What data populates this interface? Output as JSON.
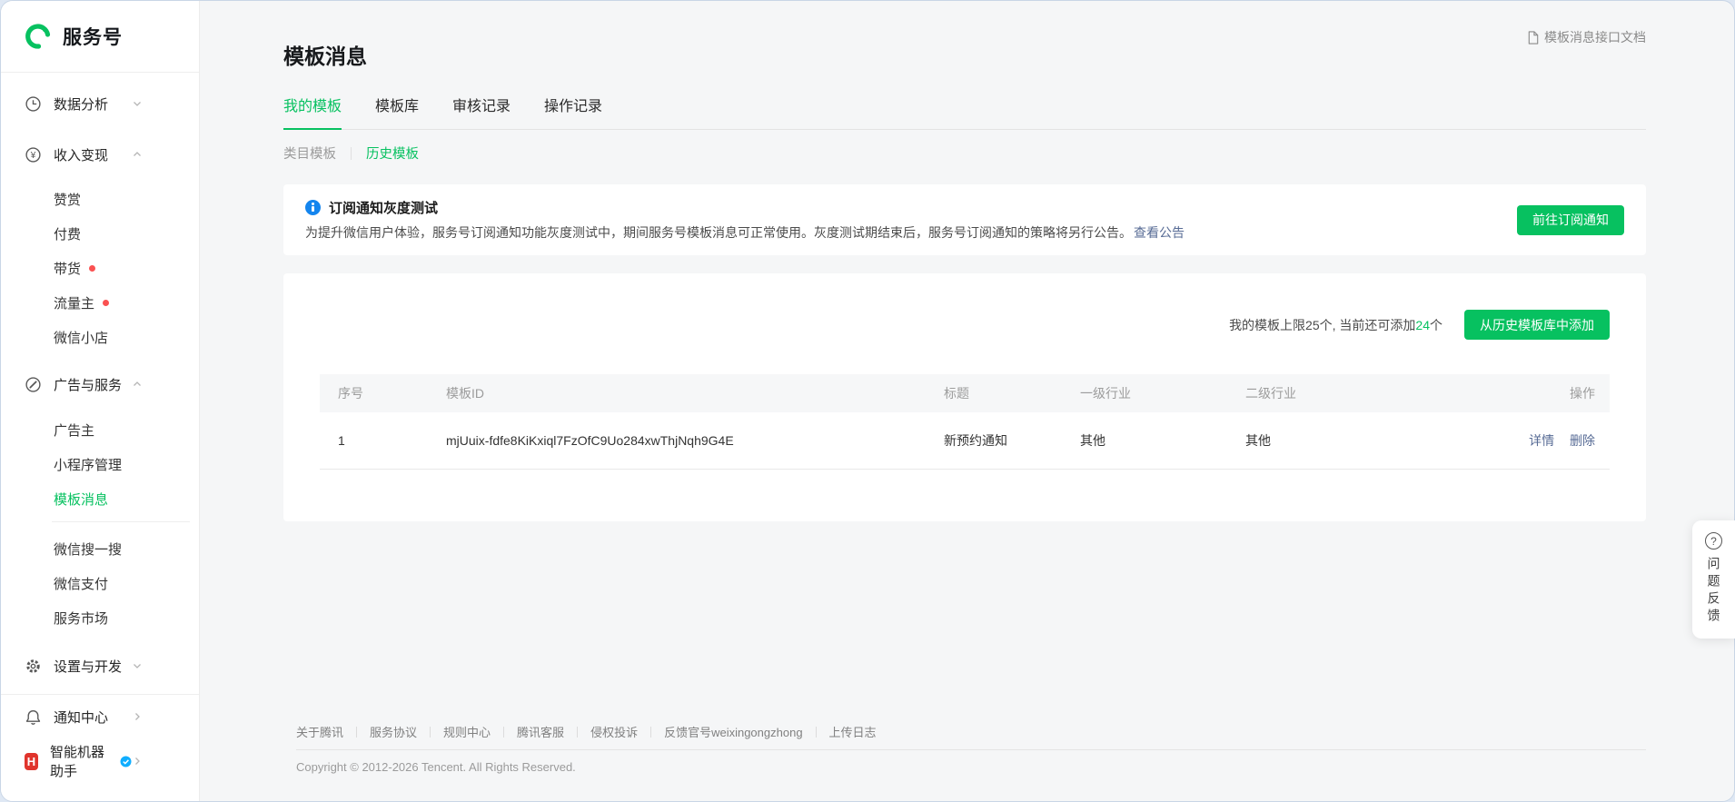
{
  "colors": {
    "accent": "#07c160",
    "link_blue": "#576b95",
    "info_blue": "#1485ee",
    "red_dot": "#fa5151"
  },
  "icons": {
    "yen": "¥",
    "question_mark": "?",
    "assistant_letter": "H"
  },
  "sidebar": {
    "logo": "服务号",
    "items": [
      {
        "label": "数据分析"
      },
      {
        "label": "收入变现"
      },
      {
        "label": "赞赏"
      },
      {
        "label": "付费"
      },
      {
        "label": "带货"
      },
      {
        "label": "流量主"
      },
      {
        "label": "微信小店"
      },
      {
        "label": "广告与服务"
      },
      {
        "label": "广告主"
      },
      {
        "label": "小程序管理"
      },
      {
        "label": "模板消息"
      },
      {
        "label": "微信搜一搜"
      },
      {
        "label": "微信支付"
      },
      {
        "label": "服务市场"
      },
      {
        "label": "设置与开发"
      },
      {
        "label": "通知中心"
      },
      {
        "label": "智能机器助手"
      }
    ]
  },
  "header": {
    "title": "模板消息",
    "doc_link": "模板消息接口文档"
  },
  "tabs": [
    {
      "label": "我的模板",
      "active": true
    },
    {
      "label": "模板库",
      "active": false
    },
    {
      "label": "审核记录",
      "active": false
    },
    {
      "label": "操作记录",
      "active": false
    }
  ],
  "subtabs": [
    {
      "label": "类目模板",
      "active": false
    },
    {
      "label": "历史模板",
      "active": true
    }
  ],
  "banner": {
    "title": "订阅通知灰度测试",
    "body": "为提升微信用户体验，服务号订阅通知功能灰度测试中，期间服务号模板消息可正常使用。灰度测试期结束后，服务号订阅通知的策略将另行公告。",
    "link": "查看公告",
    "button": "前往订阅通知"
  },
  "panel": {
    "limit_prefix": "我的模板上限25个, 当前还可添加",
    "limit_count": "24",
    "limit_suffix": "个",
    "add_button": "从历史模板库中添加"
  },
  "table": {
    "columns": [
      "序号",
      "模板ID",
      "标题",
      "一级行业",
      "二级行业",
      "操作"
    ],
    "rows": [
      {
        "no": "1",
        "template_id": "mjUuix-fdfe8KiKxiql7FzOfC9Uo284xwThjNqh9G4E",
        "title": "新预约通知",
        "industry_level1": "其他",
        "industry_level2": "其他",
        "actions": [
          "详情",
          "删除"
        ]
      }
    ]
  },
  "footer": {
    "links": [
      "关于腾讯",
      "服务协议",
      "规则中心",
      "腾讯客服",
      "侵权投诉",
      "反馈官号weixingongzhong",
      "上传日志"
    ],
    "copyright": "Copyright © 2012-2026 Tencent. All Rights Reserved."
  },
  "feedback": {
    "label": "问题反馈"
  }
}
